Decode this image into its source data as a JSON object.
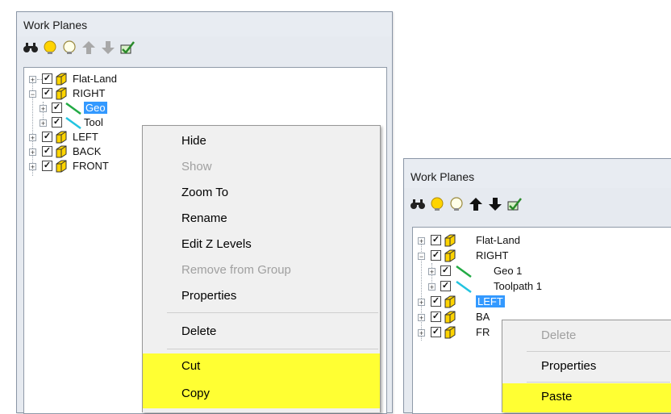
{
  "panel1": {
    "title": "Work Planes",
    "toolbar": [
      "find-icon",
      "bulb-on-icon",
      "bulb-off-icon",
      "arrow-up-icon",
      "arrow-down-icon",
      "edit-check-icon"
    ],
    "tree": {
      "flat_land": "Flat-Land",
      "right": "RIGHT",
      "geo": "Geo",
      "tool": "Tool",
      "left": "LEFT",
      "back": "BACK",
      "front": "FRONT"
    },
    "menu": {
      "hide": "Hide",
      "show": "Show",
      "zoom_to": "Zoom To",
      "rename": "Rename",
      "edit_z_levels": "Edit Z Levels",
      "remove_from_group": "Remove from Group",
      "properties": "Properties",
      "delete": "Delete",
      "cut": "Cut",
      "copy": "Copy"
    }
  },
  "panel2": {
    "title": "Work Planes",
    "tree": {
      "flat_land": "Flat-Land",
      "right": "RIGHT",
      "geo1": "Geo 1",
      "toolpath1": "Toolpath 1",
      "left": "LEFT",
      "back": "BA",
      "front": "FR"
    },
    "menu": {
      "delete": "Delete",
      "properties": "Properties",
      "paste": "Paste"
    }
  },
  "colors": {
    "highlight": "#ffff33",
    "selection": "#3399ff",
    "panel_bg": "#e6eaf0",
    "bulb_yellow": "#ffd400"
  }
}
